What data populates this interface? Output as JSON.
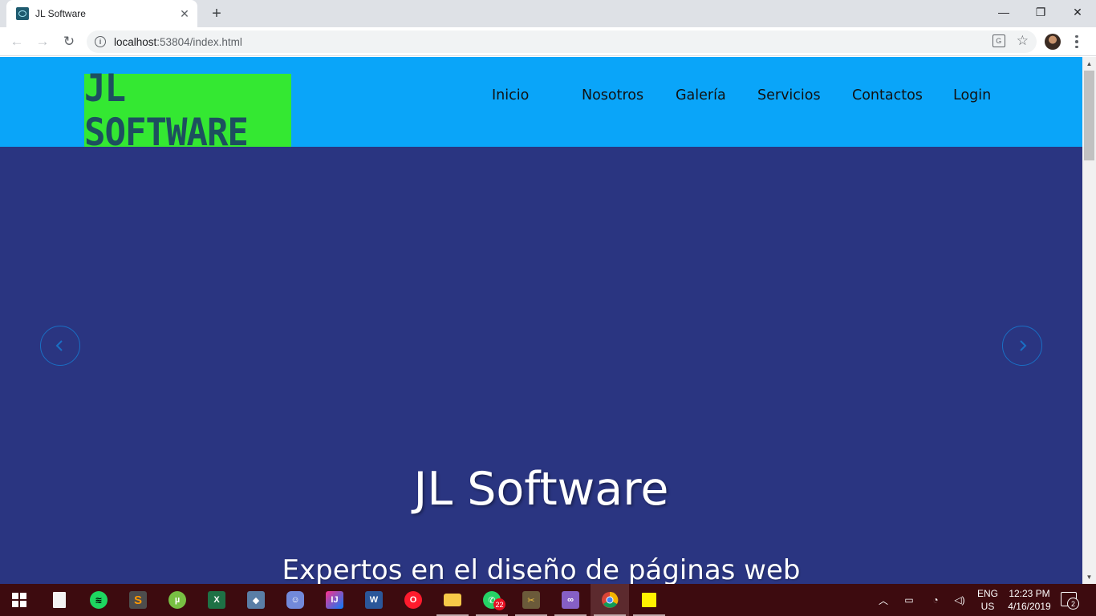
{
  "browser": {
    "tab_title": "JL Software",
    "new_tab_label": "+",
    "url_host": "localhost",
    "url_rest": ":53804/index.html",
    "back_glyph": "←",
    "forward_glyph": "→",
    "reload_glyph": "↻",
    "close_tab_glyph": "✕",
    "minimize_glyph": "—",
    "restore_glyph": "❐",
    "close_window_glyph": "✕",
    "star_glyph": "☆"
  },
  "site": {
    "logo_text": "JL SOFTWARE",
    "nav": [
      {
        "label": "Inicio"
      },
      {
        "label": "Nosotros"
      },
      {
        "label": "Galería"
      },
      {
        "label": "Servicios"
      },
      {
        "label": "Contactos"
      },
      {
        "label": "Login"
      }
    ],
    "hero_title": "JL Software",
    "hero_subtitle": "Expertos en el diseño de páginas web",
    "colors": {
      "header_bg": "#0aa5f9",
      "logo_bg": "#34e832",
      "hero_bg": "#2a3581",
      "arrow_color": "#1a6fc4"
    }
  },
  "taskbar": {
    "whatsapp_badge": "22",
    "lang_top": "ENG",
    "lang_bottom": "US",
    "time": "12:23 PM",
    "date": "4/16/2019",
    "notification_count": "2",
    "apps": [
      {
        "name": "start-menu-icon"
      },
      {
        "name": "file-icon"
      },
      {
        "name": "spotify-icon"
      },
      {
        "name": "sublime-text-icon"
      },
      {
        "name": "utorrent-icon"
      },
      {
        "name": "excel-icon"
      },
      {
        "name": "virtualbox-icon"
      },
      {
        "name": "discord-icon"
      },
      {
        "name": "intellij-icon"
      },
      {
        "name": "word-icon"
      },
      {
        "name": "opera-icon"
      },
      {
        "name": "file-explorer-icon"
      },
      {
        "name": "whatsapp-icon"
      },
      {
        "name": "tools-icon"
      },
      {
        "name": "visual-studio-icon"
      },
      {
        "name": "chrome-icon"
      },
      {
        "name": "sticky-notes-icon"
      }
    ]
  }
}
